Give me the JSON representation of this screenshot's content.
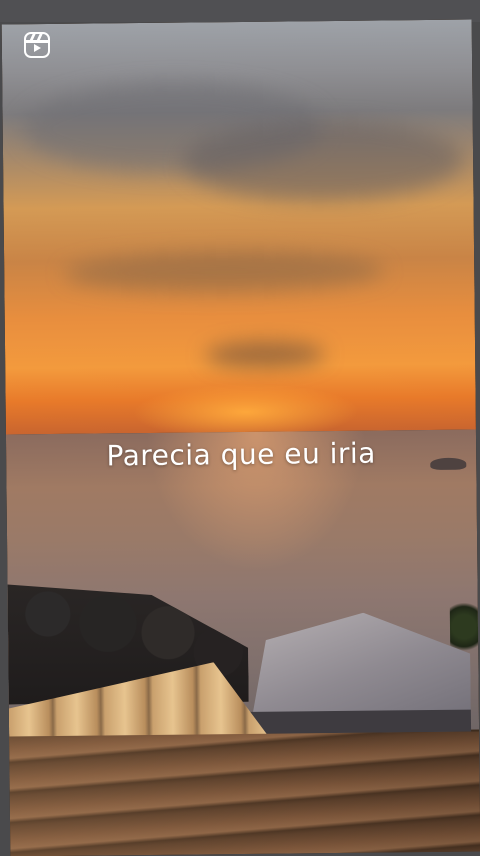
{
  "story": {
    "caption": "Parecia que eu iria"
  },
  "icons": {
    "reels": "reels-icon"
  },
  "colors": {
    "caption_text": "#ffffff",
    "sunset_orange": "#f39a3d",
    "frame_background": "#4a4a4c"
  }
}
